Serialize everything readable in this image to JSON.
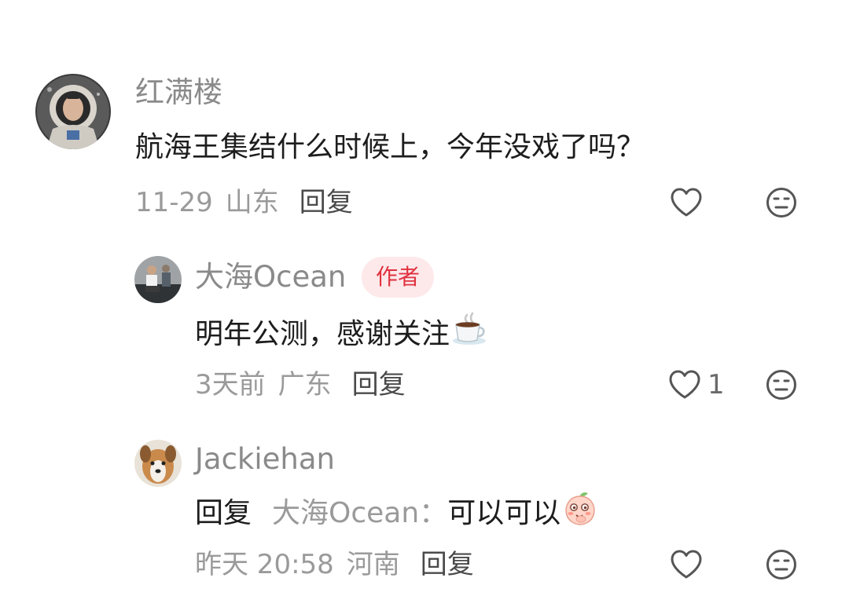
{
  "comments": [
    {
      "username": "红满楼",
      "content": "航海王集结什么时候上，今年没戏了吗？",
      "time": "11-29",
      "location": "山东",
      "reply_label": "回复",
      "avatar": "astronaut-avatar",
      "like_icon": "heart-outline-icon",
      "dislike_icon": "neutral-face-icon"
    },
    {
      "username": "大海Ocean",
      "badge": "作者",
      "content": "明年公测，感谢关注",
      "content_emoji": "coffee-cup-emoji",
      "time": "3天前",
      "location": "广东",
      "reply_label": "回复",
      "like_count": "1",
      "avatar": "man-sitting-avatar",
      "like_icon": "heart-outline-icon",
      "dislike_icon": "neutral-face-icon"
    },
    {
      "username": "Jackiehan",
      "reply_prefix": "回复",
      "reply_target": "大海Ocean",
      "reply_sep": "：",
      "content": "可以可以",
      "content_emoji": "peach-blush-emoji",
      "time": "昨天 20:58",
      "location": "河南",
      "reply_label": "回复",
      "avatar": "dog-avatar",
      "like_icon": "heart-outline-icon",
      "dislike_icon": "neutral-face-icon"
    }
  ],
  "colors": {
    "username": "#8a8a8a",
    "content": "#1d1d1d",
    "meta": "#9a9a9a",
    "badge_bg": "#fde8ea",
    "badge_text": "#e0323f",
    "icon_stroke": "#555555"
  }
}
